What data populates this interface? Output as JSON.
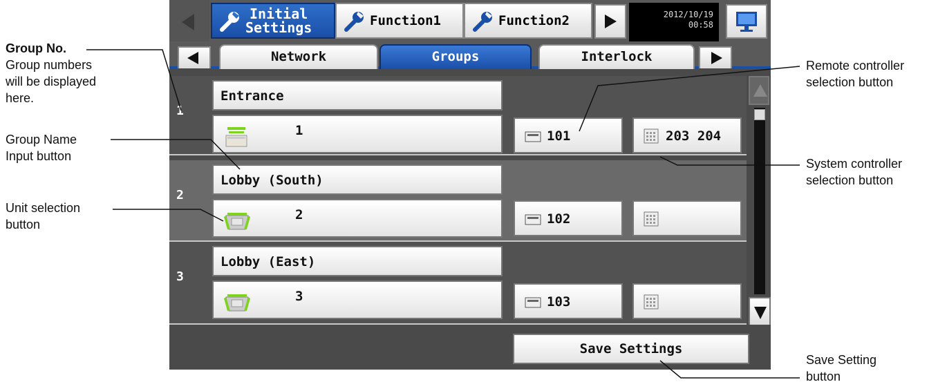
{
  "header": {
    "tabs": [
      {
        "label_line1": "Initial",
        "label_line2": "Settings",
        "active": true,
        "icon": "wrench-icon"
      },
      {
        "label": "Function1",
        "active": false,
        "icon": "wrench-icon"
      },
      {
        "label": "Function2",
        "active": false,
        "icon": "wrench-icon"
      }
    ],
    "date": "2012/10/19",
    "time": "00:58",
    "monitor_icon": "monitor-icon"
  },
  "subtabs": [
    {
      "label": "Network",
      "active": false
    },
    {
      "label": "Groups",
      "active": true
    },
    {
      "label": "Interlock",
      "active": false
    }
  ],
  "groups": [
    {
      "number": "1",
      "name": "Entrance",
      "unit": "1",
      "unit_icon": "ceiling-unit-icon",
      "remote": "101",
      "system": "203 204"
    },
    {
      "number": "2",
      "name": "Lobby (South)",
      "unit": "2",
      "unit_icon": "cassette-unit-icon",
      "remote": "102",
      "system": ""
    },
    {
      "number": "3",
      "name": "Lobby (East)",
      "unit": "3",
      "unit_icon": "cassette-unit-icon",
      "remote": "103",
      "system": ""
    }
  ],
  "footer": {
    "save_label": "Save Settings"
  },
  "annotations": {
    "group_no_title": "Group No.",
    "group_no_line1": "Group numbers",
    "group_no_line2": "will be displayed",
    "group_no_line3": "here.",
    "group_name_line1": "Group Name",
    "group_name_line2": "Input button",
    "unit_sel_line1": "Unit selection",
    "unit_sel_line2": "button",
    "remote_line1": "Remote controller",
    "remote_line2": "selection button",
    "system_line1": "System controller",
    "system_line2": "selection button",
    "save_line1": "Save Setting",
    "save_line2": "button"
  },
  "colors": {
    "accent_blue": "#1a4fa8",
    "screen_bg": "#4a4a4a",
    "unit_green": "#7ed321"
  }
}
